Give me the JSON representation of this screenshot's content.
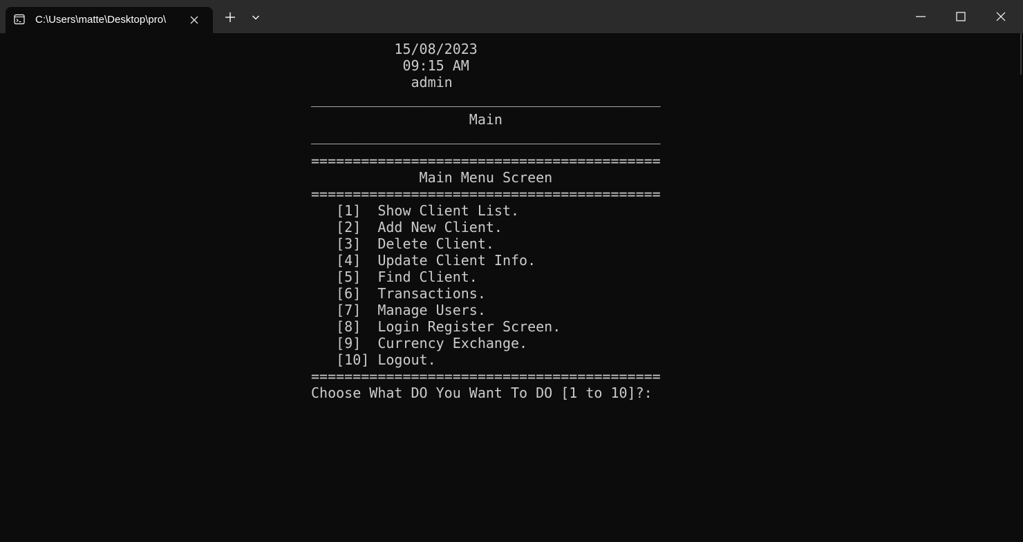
{
  "window": {
    "tab_title": "C:\\Users\\matte\\Desktop\\pro\\",
    "icons": {
      "tab": "terminal-icon",
      "tab_close": "close-icon",
      "new_tab": "plus-icon",
      "dropdown": "chevron-down-icon",
      "minimize": "minimize-icon",
      "maximize": "maximize-icon",
      "close": "close-icon"
    }
  },
  "header": {
    "date": "          15/08/2023",
    "time": "           09:15 AM",
    "user": "            admin",
    "separator": "__________________________________________",
    "screen_title": "                   Main"
  },
  "menu": {
    "border": "==========================================",
    "title": "             Main Menu Screen",
    "items": [
      "   [1]  Show Client List.",
      "   [2]  Add New Client.",
      "   [3]  Delete Client.",
      "   [4]  Update Client Info.",
      "   [5]  Find Client.",
      "   [6]  Transactions.",
      "   [7]  Manage Users.",
      "   [8]  Login Register Screen.",
      "   [9]  Currency Exchange.",
      "   [10] Logout."
    ],
    "prompt": "Choose What DO You Want To DO [1 to 10]?: "
  },
  "colors": {
    "background": "#0c0c0c",
    "titlebar": "#2b2b2b",
    "text": "#cccccc"
  }
}
